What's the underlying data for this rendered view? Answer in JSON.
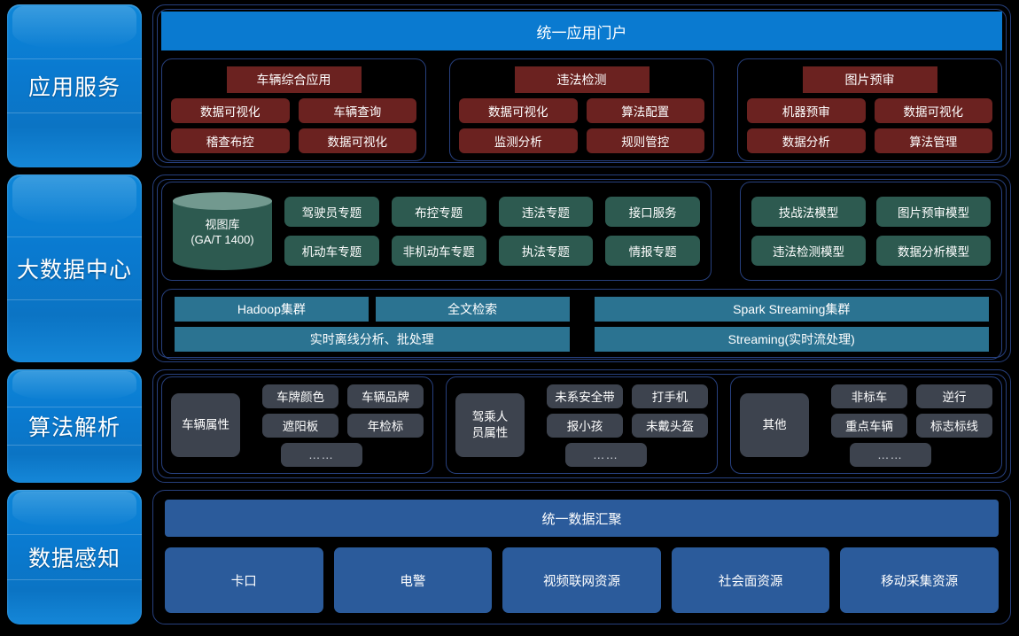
{
  "sidebar": {
    "items": [
      {
        "label": "应用服务"
      },
      {
        "label": "大数据中心"
      },
      {
        "label": "算法解析"
      },
      {
        "label": "数据感知"
      }
    ]
  },
  "application_layer": {
    "portal_title": "统一应用门户",
    "groups": [
      {
        "title": "车辆综合应用",
        "buttons": [
          "数据可视化",
          "车辆查询",
          "稽查布控",
          "数据可视化"
        ]
      },
      {
        "title": "违法检测",
        "buttons": [
          "数据可视化",
          "算法配置",
          "监测分析",
          "规则管控"
        ]
      },
      {
        "title": "图片预审",
        "buttons": [
          "机器预审",
          "数据可视化",
          "数据分析",
          "算法管理"
        ]
      }
    ]
  },
  "bigdata_layer": {
    "database": {
      "name": "视图库",
      "standard": "(GA/T 1400)"
    },
    "subjects": [
      "驾驶员专题",
      "布控专题",
      "违法专题",
      "接口服务",
      "机动车专题",
      "非机动车专题",
      "执法专题",
      "情报专题"
    ],
    "models": [
      "技战法模型",
      "图片预审模型",
      "违法检测模型",
      "数据分析模型"
    ],
    "clusters": {
      "left_top": [
        "Hadoop集群",
        "全文检索"
      ],
      "left_bottom": "实时离线分析、批处理",
      "right_top": "Spark Streaming集群",
      "right_bottom": "Streaming(实时流处理)"
    }
  },
  "algorithm_layer": {
    "groups": [
      {
        "main": "车辆属性",
        "row1": [
          "车牌颜色",
          "车辆品牌"
        ],
        "row2": [
          "遮阳板",
          "年检标"
        ],
        "more": "……"
      },
      {
        "main": "驾乘人\n员属性",
        "main_line1": "驾乘人",
        "main_line2": "员属性",
        "row1": [
          "未系安全带",
          "打手机"
        ],
        "row2": [
          "报小孩",
          "未戴头盔"
        ],
        "more": "……"
      },
      {
        "main": "其他",
        "row1": [
          "非标车",
          "逆行"
        ],
        "row2": [
          "重点车辆",
          "标志标线"
        ],
        "more": "……"
      }
    ]
  },
  "perception_layer": {
    "gather_title": "统一数据汇聚",
    "sources": [
      "卡口",
      "电警",
      "视频联网资源",
      "社会面资源",
      "移动采集资源"
    ]
  },
  "colors": {
    "background": "#000000",
    "sidebar_blue": "#0a7ad0",
    "portal_blue": "#0a7ad0",
    "app_red": "#6b2220",
    "subject_green": "#2d5a50",
    "cluster_tealblue": "#2b7391",
    "algo_gray": "#3d434e",
    "source_blue": "#2b5b9b",
    "panel_border": "#27407e"
  }
}
